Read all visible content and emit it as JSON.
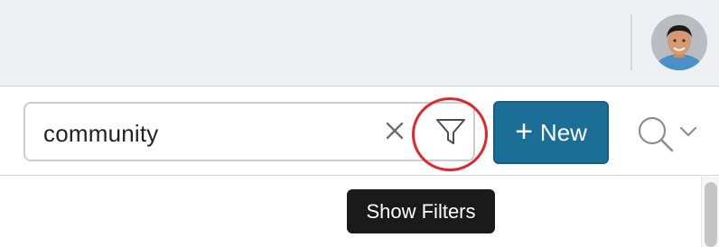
{
  "header": {
    "avatar_alt": "User avatar"
  },
  "search": {
    "query": "community",
    "clear_icon": "close-icon",
    "filter_icon": "filter-funnel-icon"
  },
  "actions": {
    "new_label": "New",
    "new_icon": "plus-icon",
    "search_toggle_icon": "magnifier-icon"
  },
  "tooltip": {
    "text": "Show Filters"
  },
  "colors": {
    "topbar_bg": "#eef0f3",
    "primary": "#1b6f96",
    "highlight": "#e3262c",
    "tooltip_bg": "#1a1a1a"
  }
}
